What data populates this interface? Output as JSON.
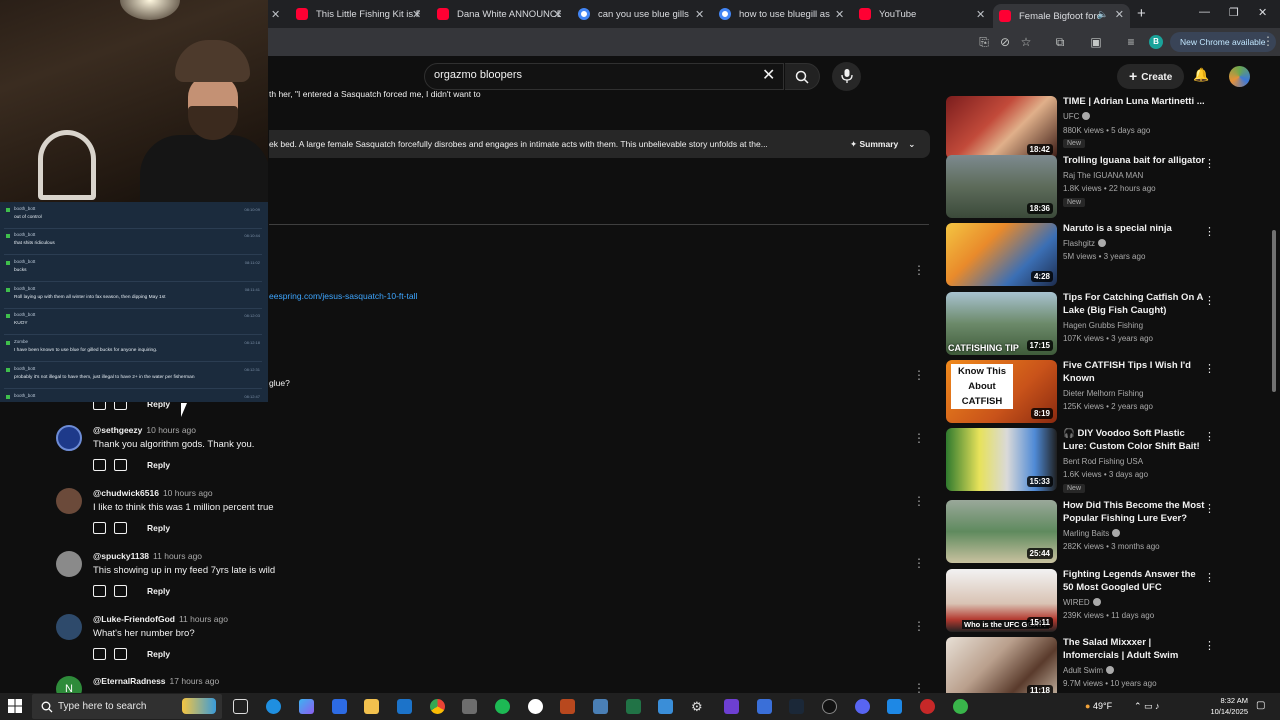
{
  "browser": {
    "tabs": [
      {
        "label": "This Little Fishing Kit is Fir",
        "icon": "youtube-icon"
      },
      {
        "label": "Dana White ANNOUNCES",
        "icon": "youtube-icon"
      },
      {
        "label": "can you use blue gills for",
        "icon": "google-icon"
      },
      {
        "label": "how to use bluegill as cut",
        "icon": "google-icon"
      },
      {
        "label": "YouTube",
        "icon": "youtube-icon"
      },
      {
        "label": "Female Bigfoot forcef",
        "icon": "youtube-icon",
        "active": true
      }
    ],
    "new_chrome_label": "New Chrome available",
    "profile_initial": "B"
  },
  "youtube": {
    "search_query": "orgazmo bloopers",
    "create_label": "Create"
  },
  "description": {
    "line1": "th her, \"I entered a Sasquatch forced me, I didn't want to",
    "summary_text": "ek bed. A large female Sasquatch forcefully disrobes and engages in intimate acts with them. This unbelievable story unfolds at the...",
    "summary_label": "Summary",
    "link": "eespring.com/jesus-sasquatch-10-ft-tall",
    "partial_comment": "glue?"
  },
  "comments": [
    {
      "handle": "@sethgeezy",
      "time": "10 hours ago",
      "text": "Thank you algorithm gods. Thank you.",
      "reply": "Reply",
      "avatar_color": "#1e3a8a"
    },
    {
      "handle": "@chudwick6516",
      "time": "10 hours ago",
      "text": "I like to think this was 1 million percent true",
      "reply": "Reply",
      "avatar_color": "#6b4a3a"
    },
    {
      "handle": "@spucky1138",
      "time": "11 hours ago",
      "text": "This showing up in my feed 7yrs late is wild",
      "reply": "Reply",
      "avatar_color": "#8a8a8a"
    },
    {
      "handle": "@Luke-FriendofGod",
      "time": "11 hours ago",
      "text": "What's her number bro?",
      "reply": "Reply",
      "avatar_color": "#2e4a6b"
    },
    {
      "handle": "@EternalRadness",
      "time": "17 hours ago",
      "text": "",
      "reply": "",
      "avatar_color": "#2e8b3a",
      "initial": "N"
    }
  ],
  "first_reply_label": "Reply",
  "chat": [
    {
      "user": "booth_bott",
      "text": "out of control",
      "time": "08:10:09"
    },
    {
      "user": "booth_bott",
      "text": "that shits ridiculous",
      "time": "08:10:44"
    },
    {
      "user": "booth_bott",
      "text": "bucks",
      "time": "08:11:02"
    },
    {
      "user": "booth_bott",
      "text": "Roll laying up with them all winter into fax season, then dipping May 1st",
      "time": "08:11:41"
    },
    {
      "user": "booth_bott",
      "text": "KUOY",
      "time": "08:12:03"
    },
    {
      "user": "Zombe",
      "text": "I have been known to use blue for gilled bucks for anyone inquiring.",
      "time": "08:12:18"
    },
    {
      "user": "booth_bott",
      "text": "probably it's not illegal to have them, just illegal to have 2+ in the water per fisherman",
      "time": "08:12:31"
    },
    {
      "user": "booth_bott",
      "text": "",
      "time": "08:12:47"
    }
  ],
  "sidebar_videos": [
    {
      "title": "TIME | Adrian Luna Martinetti ...",
      "channel": "UFC",
      "verified": true,
      "meta": "880K views • 5 days ago",
      "duration": "18:42",
      "badge": "New",
      "thumb": "ufc"
    },
    {
      "title": "Trolling Iguana bait for alligator",
      "channel": "Raj The IGUANA MAN",
      "verified": false,
      "meta": "1.8K views • 22 hours ago",
      "duration": "18:36",
      "badge": "New",
      "thumb": "boat"
    },
    {
      "title": "Naruto is a special ninja",
      "channel": "Flashgitz",
      "verified": true,
      "meta": "5M views • 3 years ago",
      "duration": "4:28",
      "badge": "",
      "thumb": "naruto"
    },
    {
      "title": "Tips For Catching Catfish On A Lake (Big Fish Caught)",
      "channel": "Hagen Grubbs Fishing",
      "verified": false,
      "meta": "107K views • 3 years ago",
      "duration": "17:15",
      "badge": "",
      "thumb": "catfish",
      "thumb_text": "CATFISHING TIP"
    },
    {
      "title": "Five CATFISH Tips I Wish I'd Known",
      "channel": "Dieter Melhorn Fishing",
      "verified": false,
      "meta": "125K views • 2 years ago",
      "duration": "8:19",
      "badge": "",
      "thumb": "know",
      "thumb_text": "Know This About CATFISH"
    },
    {
      "title": "🎧 DIY Voodoo Soft Plastic Lure: Custom Color Shift Bait! ...",
      "channel": "Bent Rod Fishing USA",
      "verified": false,
      "meta": "1.6K views • 3 days ago",
      "duration": "15:33",
      "badge": "New",
      "thumb": "voodoo"
    },
    {
      "title": "How Did This Become the Most Popular Fishing Lure Ever?",
      "channel": "Marling Baits",
      "verified": true,
      "meta": "282K views • 3 months ago",
      "duration": "25:44",
      "badge": "",
      "thumb": "lure"
    },
    {
      "title": "Fighting Legends Answer the 50 Most Googled UFC Questions |...",
      "channel": "WIRED",
      "verified": true,
      "meta": "239K views • 11 days ago",
      "duration": "15:11",
      "badge": "",
      "thumb": "wired",
      "thumb_text": "Who is the UFC GOAT?"
    },
    {
      "title": "The Salad Mixxxer | Infomercials | Adult Swim",
      "channel": "Adult Swim",
      "verified": true,
      "meta": "9.7M views • 10 years ago",
      "duration": "11:18",
      "badge": "",
      "thumb": "salad"
    }
  ],
  "taskbar": {
    "search_placeholder": "Type here to search",
    "weather": "49°F",
    "time": "8:32 AM",
    "date": "10/14/2025"
  }
}
